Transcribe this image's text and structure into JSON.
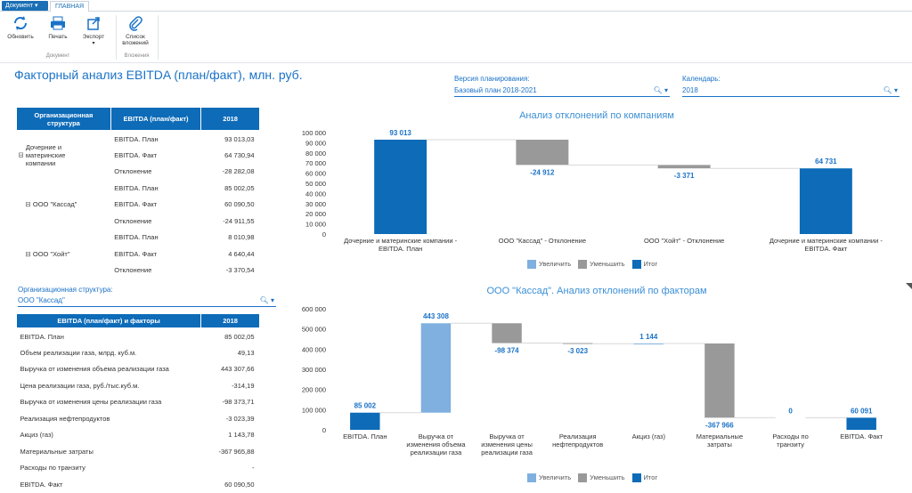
{
  "ribbon": {
    "doc_tab": "Документ",
    "main_tab": "ГЛАВНАЯ",
    "refresh": "Обновить",
    "print": "Печать",
    "export": "Экспорт",
    "attachments_line1": "Список",
    "attachments_line2": "вложений",
    "group_document": "Документ",
    "group_attachments": "Вложения"
  },
  "page_title": "Факторный анализ EBITDA (план/факт), млн. руб.",
  "filters": {
    "version_label": "Версия планирования:",
    "version_value": "Базовый план 2018-2021",
    "calendar_label": "Календарь:",
    "calendar_value": "2018",
    "org_label": "Организационная структура:",
    "org_value": "ООО \"Кассад\""
  },
  "table1": {
    "headers": [
      "Организационная структура",
      "EBITDA (план/факт)",
      "2018"
    ],
    "groups": [
      {
        "name": "Дочерние и материнские компании",
        "rows": [
          [
            "EBITDA. План",
            "93 013,03"
          ],
          [
            "EBITDA. Факт",
            "64 730,94"
          ],
          [
            "Отклонение",
            "-28 282,08"
          ]
        ]
      },
      {
        "name": "ООО \"Кассад\"",
        "rows": [
          [
            "EBITDA. План",
            "85 002,05"
          ],
          [
            "EBITDA. Факт",
            "60 090,50"
          ],
          [
            "Отклонение",
            "-24 911,55"
          ]
        ]
      },
      {
        "name": "ООО \"Хойт\"",
        "rows": [
          [
            "EBITDA. План",
            "8 010,98"
          ],
          [
            "EBITDA. Факт",
            "4 640,44"
          ],
          [
            "Отклонение",
            "-3 370,54"
          ]
        ]
      }
    ]
  },
  "table2": {
    "headers": [
      "EBITDA (план/факт) и факторы",
      "2018"
    ],
    "rows": [
      [
        "EBITDA. План",
        "85 002,05"
      ],
      [
        "Объем реализации газа, млрд. куб.м.",
        "49,13"
      ],
      [
        "Выручка от изменения объема реализации газа",
        "443 307,66"
      ],
      [
        "Цена реализации газа, руб./тыс.куб.м.",
        "-314,19"
      ],
      [
        "Выручка от изменения цены реализации газа",
        "-98 373,71"
      ],
      [
        "Реализация нефтепродуктов",
        "-3 023,39"
      ],
      [
        "Акциз (газ)",
        "1 143,78"
      ],
      [
        "Материальные затраты",
        "-367 965,88"
      ],
      [
        "Расходы по транзиту",
        "-"
      ],
      [
        "EBITDA. Факт",
        "60 090,50"
      ]
    ]
  },
  "legend": {
    "increase": "Увеличить",
    "decrease": "Уменьшить",
    "total": "Итог"
  },
  "colors": {
    "total": "#0d6bb8",
    "increase": "#7fb0e0",
    "decrease": "#999999",
    "accent": "#1a72c7"
  },
  "chart_data": [
    {
      "type": "bar",
      "subtype": "waterfall",
      "title": "Анализ отклонений по компаниям",
      "categories": [
        "Дочерние и материнские компании - EBITDA. План",
        "ООО \"Кассад\" - Отклонение",
        "ООО \"Хойт\" - Отклонение",
        "Дочерние и материнские компании - EBITDA. Факт"
      ],
      "values": [
        93013,
        -24912,
        -3371,
        64731
      ],
      "kinds": [
        "total",
        "decrease",
        "decrease",
        "total"
      ],
      "data_labels": [
        "93 013",
        "-24 912",
        "-3 371",
        "64 731"
      ],
      "ylim": [
        0,
        100000
      ],
      "yticks": [
        "0",
        "10 000",
        "20 000",
        "30 000",
        "40 000",
        "50 000",
        "60 000",
        "70 000",
        "80 000",
        "90 000",
        "100 000"
      ]
    },
    {
      "type": "bar",
      "subtype": "waterfall",
      "title": "ООО \"Кассад\". Анализ отклонений по факторам",
      "categories": [
        "EBITDA. План",
        "Выручка от изменения объема реализации газа",
        "Выручка от изменения цены реализации газа",
        "Реализация нефтепродуктов",
        "Акциз (газ)",
        "Материальные затраты",
        "Расходы по транзиту",
        "EBITDA. Факт"
      ],
      "values": [
        85002,
        443308,
        -98374,
        -3023,
        1144,
        -367966,
        0,
        60091
      ],
      "kinds": [
        "total",
        "increase",
        "decrease",
        "decrease",
        "increase",
        "decrease",
        "increase",
        "total"
      ],
      "data_labels": [
        "85 002",
        "443 308",
        "-98 374",
        "-3 023",
        "1 144",
        "-367 966",
        "0",
        "60 091"
      ],
      "ylim": [
        0,
        600000
      ],
      "yticks": [
        "0",
        "100 000",
        "200 000",
        "300 000",
        "400 000",
        "500 000",
        "600 000"
      ]
    }
  ]
}
